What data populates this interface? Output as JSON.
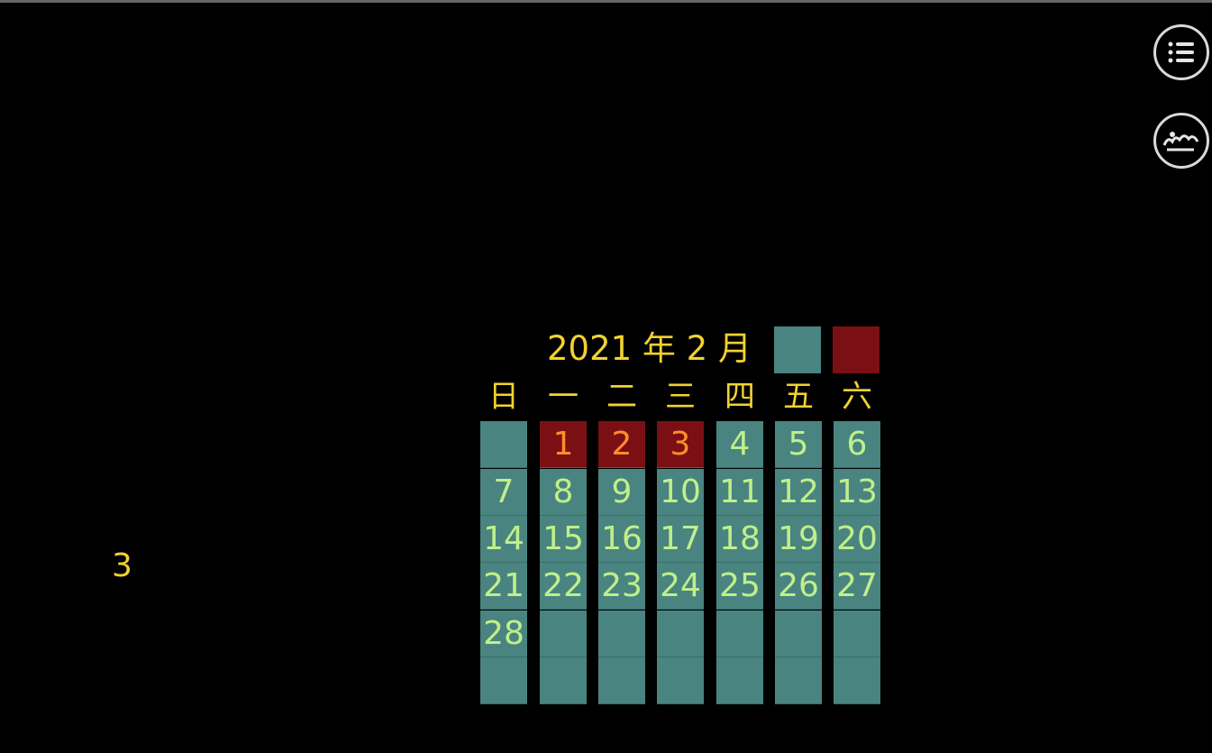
{
  "calendar": {
    "title": "2021 年 2 月",
    "weekdays": [
      "日",
      "一",
      "二",
      "三",
      "四",
      "五",
      "六"
    ],
    "days": [
      [
        "",
        "1",
        "2",
        "3",
        "4",
        "5",
        "6"
      ],
      [
        "7",
        "8",
        "9",
        "10",
        "11",
        "12",
        "13"
      ],
      [
        "14",
        "15",
        "16",
        "17",
        "18",
        "19",
        "20"
      ],
      [
        "21",
        "22",
        "23",
        "24",
        "25",
        "26",
        "27"
      ],
      [
        "28",
        "",
        "",
        "",
        "",
        "",
        ""
      ],
      [
        "",
        "",
        "",
        "",
        "",
        "",
        ""
      ]
    ],
    "holidays": [
      "1",
      "2",
      "3"
    ],
    "legend": {
      "normal_color": "#4a8480",
      "holiday_color": "#7a1014"
    }
  },
  "counter": {
    "value": "3"
  },
  "side_buttons": [
    {
      "icon": "list-icon"
    },
    {
      "icon": "logo-icon"
    }
  ],
  "colors": {
    "background": "#000000",
    "text_accent": "#f2d22e",
    "day_text": "#bff08a",
    "holiday_text": "#ff8c2a"
  }
}
